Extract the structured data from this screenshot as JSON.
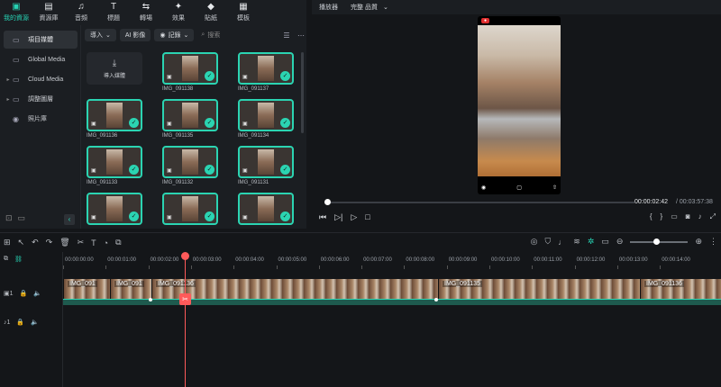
{
  "nav": {
    "tabs": [
      {
        "icon": "folder-media-icon",
        "label": "我的資源"
      },
      {
        "icon": "library-icon",
        "label": "資源庫"
      },
      {
        "icon": "music-icon",
        "label": "音頻"
      },
      {
        "icon": "text-icon",
        "label": "標題"
      },
      {
        "icon": "transition-icon",
        "label": "轉場"
      },
      {
        "icon": "effects-icon",
        "label": "效果"
      },
      {
        "icon": "sticker-icon",
        "label": "貼紙"
      },
      {
        "icon": "template-icon",
        "label": "模板"
      }
    ]
  },
  "sidebar": {
    "items": [
      {
        "label": "項目媒體",
        "active": true
      },
      {
        "label": "Global Media"
      },
      {
        "label": "Cloud Media"
      },
      {
        "label": "調整圖層"
      },
      {
        "label": "照片庫"
      }
    ]
  },
  "media_toolbar": {
    "import_label": "導入",
    "ai_label": "AI 影像",
    "record_label": "記錄",
    "search_placeholder": "搜索"
  },
  "media": {
    "import_box_label": "導入媒體",
    "items": [
      "IMG_091138",
      "IMG_091137",
      "IMG_091136",
      "IMG_091135",
      "IMG_091134",
      "IMG_091133",
      "IMG_091132",
      "IMG_091131",
      "",
      "",
      ""
    ]
  },
  "player": {
    "tab_label": "播放器",
    "quality_label": "完整 品質",
    "current_time": "00:00:02:42",
    "total_time": "/ 00:03:57:38",
    "progress": 0.01
  },
  "timeline": {
    "ruler": [
      "00:00:00:00",
      "00:00:01:00",
      "00:00:02:00",
      "00:00:03:00",
      "00:00:04:00",
      "00:00:05:00",
      "00:00:06:00",
      "00:00:07:00",
      "00:00:08:00",
      "00:00:09:00",
      "00:00:10:00",
      "00:00:11:00",
      "00:00:12:00",
      "00:00:13:00",
      "00:00:14:00"
    ],
    "tracks": [
      {
        "label": "1"
      },
      {
        "label": "1"
      }
    ],
    "clips": [
      "IMG_091",
      "IMG_091",
      "IMG_091136",
      "IMG_091135",
      "IMG_091136"
    ],
    "zoom": 0.45
  }
}
